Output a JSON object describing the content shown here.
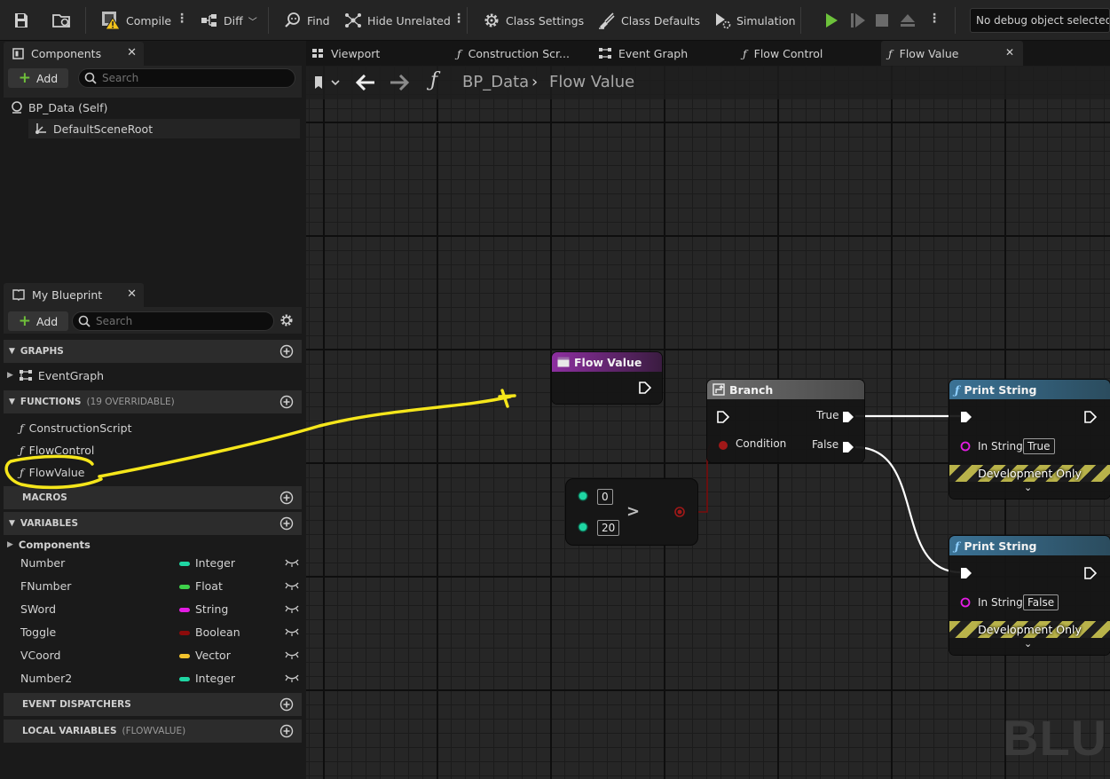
{
  "toolbar": {
    "compile": "Compile",
    "diff": "Diff",
    "find": "Find",
    "hide_unrelated": "Hide Unrelated",
    "class_settings": "Class Settings",
    "class_defaults": "Class Defaults",
    "simulation": "Simulation",
    "debug_object": "No debug object selected"
  },
  "components_panel": {
    "title": "Components",
    "add_label": "Add",
    "search_placeholder": "Search",
    "items": [
      "BP_Data (Self)",
      "DefaultSceneRoot"
    ]
  },
  "my_blueprint": {
    "title": "My Blueprint",
    "add_label": "Add",
    "search_placeholder": "Search",
    "graphs_label": "GRAPHS",
    "graphs": [
      "EventGraph"
    ],
    "functions_label": "FUNCTIONS",
    "functions_sub": "(19 OVERRIDABLE)",
    "functions": [
      "ConstructionScript",
      "FlowControl",
      "FlowValue"
    ],
    "macros_label": "MACROS",
    "variables_label": "VARIABLES",
    "components_label": "Components",
    "variables": [
      {
        "name": "Number",
        "type": "Integer",
        "color": "#1fd6a3"
      },
      {
        "name": "FNumber",
        "type": "Float",
        "color": "#3ed14a"
      },
      {
        "name": "SWord",
        "type": "String",
        "color": "#e31ce3"
      },
      {
        "name": "Toggle",
        "type": "Boolean",
        "color": "#8c0b0b"
      },
      {
        "name": "VCoord",
        "type": "Vector",
        "color": "#f2c22d"
      },
      {
        "name": "Number2",
        "type": "Integer",
        "color": "#1fd6a3"
      }
    ],
    "event_dispatchers_label": "EVENT DISPATCHERS",
    "local_variables_label": "LOCAL VARIABLES",
    "local_variables_sub": "(FLOWVALUE)"
  },
  "graph_tabs": [
    "Viewport",
    "Construction Scr...",
    "Event Graph",
    "Flow Control",
    "Flow Value"
  ],
  "breadcrumb": {
    "root": "BP_Data",
    "current": "Flow Value"
  },
  "nodes": {
    "entry": {
      "title": "Flow Value"
    },
    "compare": {
      "a": "0",
      "b": "20",
      "op": ">"
    },
    "branch": {
      "title": "Branch",
      "true_label": "True",
      "false_label": "False",
      "condition_label": "Condition"
    },
    "print_true": {
      "title": "Print String",
      "in_string_label": "In String",
      "in_string_value": "True",
      "footer": "Development Only"
    },
    "print_false": {
      "title": "Print String",
      "in_string_label": "In String",
      "in_string_value": "False",
      "footer": "Development Only"
    }
  },
  "watermark": "BLUE",
  "colors": {
    "annotation": "#f5e61b",
    "entry_header": "#7a2c88",
    "branch_header": "#5a5a5a",
    "print_header": "#3c6f8c"
  }
}
